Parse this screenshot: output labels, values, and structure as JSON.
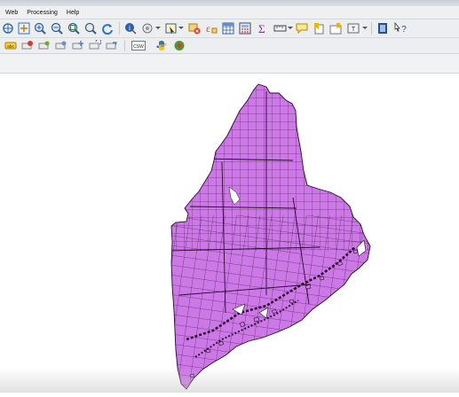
{
  "menubar": {
    "items": [
      "Web",
      "Processing",
      "Help"
    ]
  },
  "toolbar_main": {
    "icons": [
      "pan-map-icon",
      "pan-to-selection-icon",
      "zoom-in-icon",
      "zoom-out-icon",
      "zoom-full-icon",
      "zoom-layer-icon",
      "refresh-icon",
      "identify-icon",
      "select-feature-icon",
      "select-features-dropdown-icon",
      "deselect-icon",
      "expression-select-icon",
      "open-attribute-table-icon",
      "field-calculator-icon",
      "statistics-sum-icon",
      "measure-line-icon",
      "map-tips-icon",
      "new-bookmark-icon",
      "show-bookmarks-icon",
      "text-annotation-icon",
      "layout-manager-icon",
      "help-whats-this-icon"
    ]
  },
  "toolbar_labels": {
    "icons": [
      "label-tool-icon",
      "pin-labels-icon",
      "highlight-pinned-icon",
      "show-hide-labels-icon",
      "move-label-icon",
      "rotate-label-icon",
      "change-label-icon",
      "csw-search-icon",
      "python-console-icon",
      "processing-toolbox-icon"
    ],
    "csw_label": "CSW"
  },
  "map": {
    "layer_fill": "#cc78e6",
    "layer_stroke": "#2a0a2e",
    "water_color": "#ffffff"
  }
}
